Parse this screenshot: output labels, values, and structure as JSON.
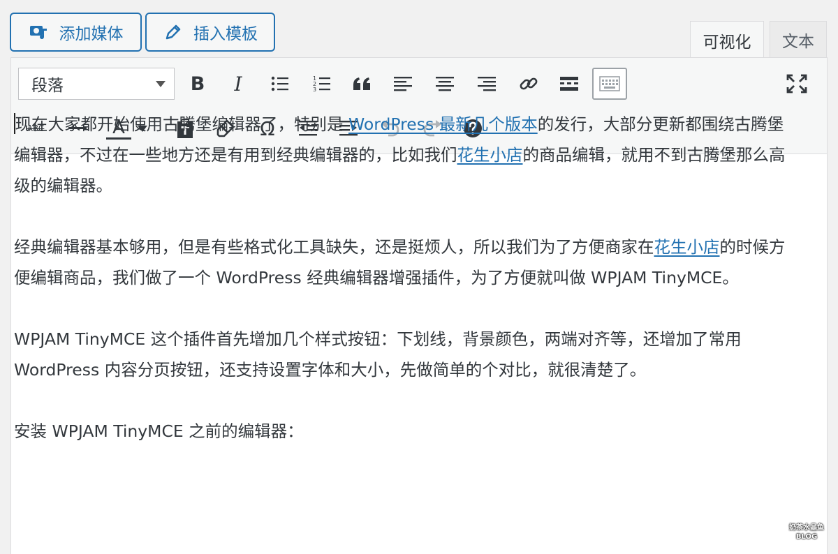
{
  "media_buttons": {
    "add_media": "添加媒体",
    "insert_template": "插入模板"
  },
  "tabs": {
    "visual": "可视化",
    "text": "文本"
  },
  "toolbar": {
    "format_select": "段落",
    "row1": [
      "bold-icon",
      "italic-icon",
      "bullet-list-icon",
      "numbered-list-icon",
      "blockquote-icon",
      "align-left-icon",
      "align-center-icon",
      "align-right-icon",
      "link-icon",
      "read-more-icon",
      "toolbar-toggle-icon",
      "fullscreen-icon"
    ],
    "row2": [
      "strikethrough-icon",
      "horizontal-line-icon",
      "text-color-icon",
      "paste-as-text-icon",
      "clear-formatting-icon",
      "special-character-icon",
      "outdent-icon",
      "indent-icon",
      "undo-icon",
      "redo-icon",
      "help-icon"
    ],
    "strikethrough_glyph": "ABC",
    "text_color_glyph": "A",
    "omega_glyph": "Ω",
    "bold_glyph": "B",
    "italic_glyph": "I"
  },
  "content": {
    "p1_a": "现在大家都开始使用古腾堡编辑器了，特别是 ",
    "p1_link1": "WordPress 最新几个版本",
    "p1_b": "的发行，大部分更新都围绕古腾堡编辑器，不过在一些地方还是有用到经典编辑器的，比如我们",
    "p1_link2": "花生小店",
    "p1_c": "的商品编辑，就用不到古腾堡那么高级的编辑器。",
    "p2_a": "经典编辑器基本够用，但是有些格式化工具缺失，还是挺烦人，所以我们为了方便商家在",
    "p2_link": "花生小店",
    "p2_b": "的时候方便编辑商品，我们做了一个 WordPress 经典编辑器增强插件，为了方便就叫做 WPJAM TinyMCE。",
    "p3": "WPJAM TinyMCE 这个插件首先增加几个样式按钮：下划线，背景颜色，两端对齐等，还增加了常用 WordPress 内容分页按钮，还支持设置字体和大小，先做简单的个对比，就很清楚了。",
    "p4": "安装 WPJAM TinyMCE 之前的编辑器："
  },
  "watermark": {
    "line1": "奶茶水晶鱼",
    "line2": "BLOG"
  }
}
